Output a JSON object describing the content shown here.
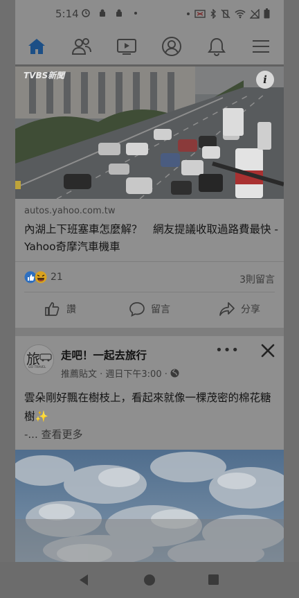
{
  "status_bar": {
    "time": "5:14"
  },
  "nav": {
    "items": [
      {
        "icon": "home-icon"
      },
      {
        "icon": "friends-icon"
      },
      {
        "icon": "watch-icon"
      },
      {
        "icon": "profile-icon"
      },
      {
        "icon": "bell-icon"
      },
      {
        "icon": "menu-icon"
      }
    ]
  },
  "post1": {
    "image_badge": "TVBS新聞",
    "domain": "autos.yahoo.com.tw",
    "title": "內湖上下班塞車怎麼解？　網友提議收取過路費最快 - Yahoo奇摩汽車機車",
    "reaction_count": "21",
    "comments_count": "3則留言",
    "actions": {
      "like": "讚",
      "comment": "留言",
      "share": "分享"
    }
  },
  "post2": {
    "page_name": "走吧！一起去旅行",
    "meta_text": "推薦貼文 · 週日下午3:00 ·",
    "avatar_text": "旅",
    "avatar_subtext": "GO TRAVEL",
    "text": "雲朵剛好飄在樹枝上，看起來就像一棵茂密的棉花糖樹✨",
    "see_more": "-... 查看更多"
  }
}
